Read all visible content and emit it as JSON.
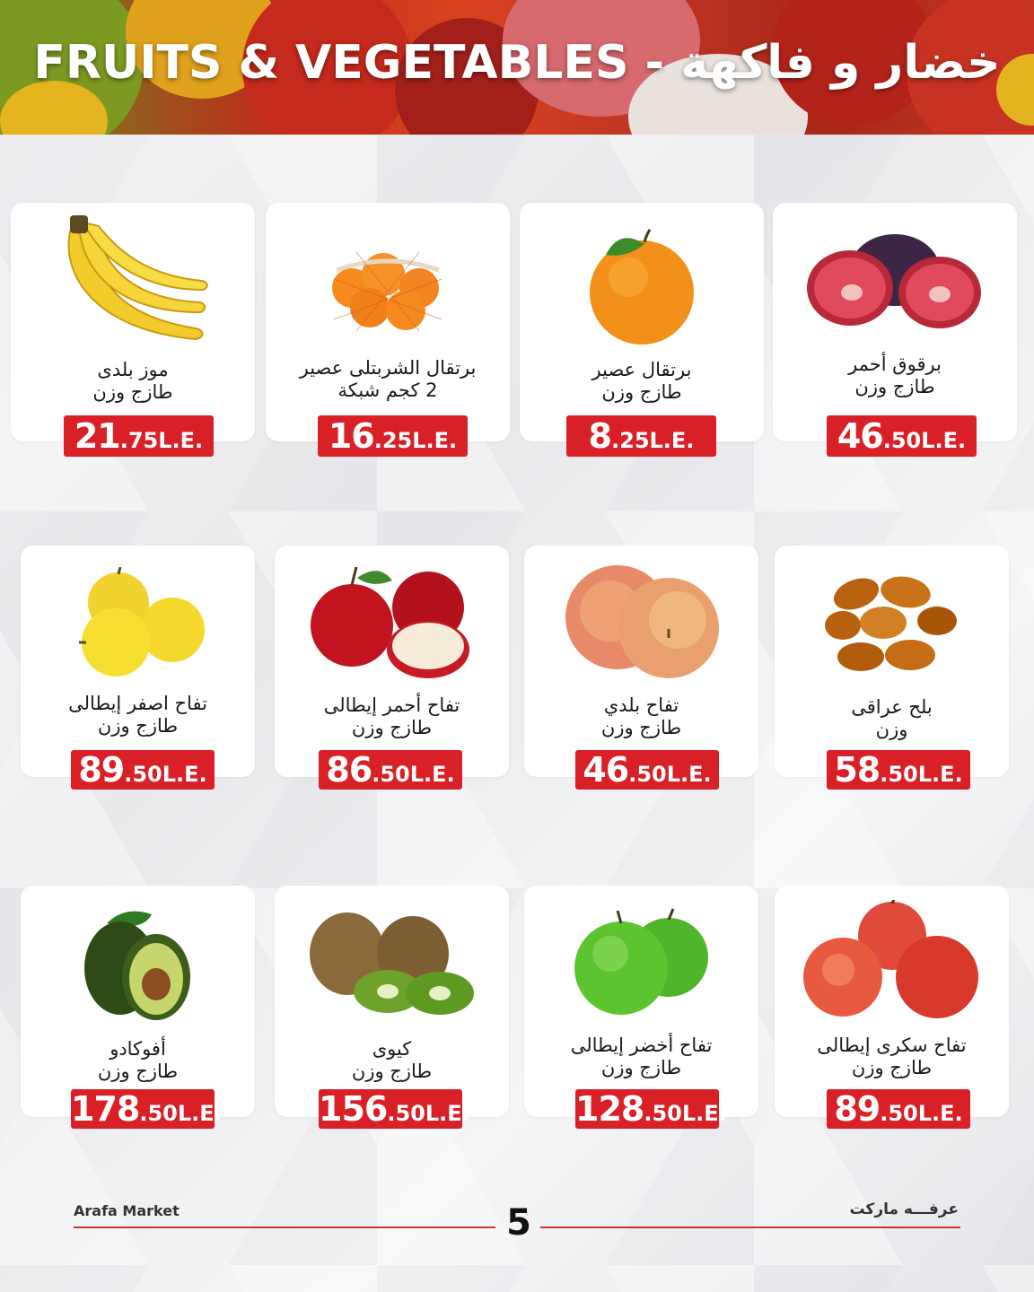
{
  "header": {
    "title": "FRUITS & VEGETABLES - خضار و فاكهة"
  },
  "products": [
    {
      "name_line1": "موز بلدى",
      "name_line2": "طازج وزن",
      "price_main": "21",
      "price_rest": ".75L.E.",
      "icon": "banana-icon"
    },
    {
      "name_line1": "برتقال الشربتلى عصير",
      "name_line2": "2 كجم شبكة",
      "price_main": "16",
      "price_rest": ".25L.E.",
      "icon": "orange-net-icon"
    },
    {
      "name_line1": "برتقال عصير",
      "name_line2": "طازج وزن",
      "price_main": "8",
      "price_rest": ".25L.E.",
      "icon": "orange-icon"
    },
    {
      "name_line1": "برقوق أحمر",
      "name_line2": "طازج وزن",
      "price_main": "46",
      "price_rest": ".50L.E.",
      "icon": "plum-icon"
    },
    {
      "name_line1": "تفاح اصفر إيطالى",
      "name_line2": "طازج وزن",
      "price_main": "89",
      "price_rest": ".50L.E.",
      "icon": "yellow-apple-icon"
    },
    {
      "name_line1": "تفاح أحمر إيطالى",
      "name_line2": "طازج وزن",
      "price_main": "86",
      "price_rest": ".50L.E.",
      "icon": "red-apple-icon"
    },
    {
      "name_line1": "تفاح بلدي",
      "name_line2": "طازج وزن",
      "price_main": "46",
      "price_rest": ".50L.E.",
      "icon": "local-apple-icon"
    },
    {
      "name_line1": "بلح عراقى",
      "name_line2": "وزن",
      "price_main": "58",
      "price_rest": ".50L.E.",
      "icon": "dates-icon"
    },
    {
      "name_line1": "أفوكادو",
      "name_line2": "طازج وزن",
      "price_main": "178",
      "price_rest": ".50L.E.",
      "icon": "avocado-icon"
    },
    {
      "name_line1": "كيوى",
      "name_line2": "طازج وزن",
      "price_main": "156",
      "price_rest": ".50L.E.",
      "icon": "kiwi-icon"
    },
    {
      "name_line1": "تفاح أخضر إيطالى",
      "name_line2": "طازج وزن",
      "price_main": "128",
      "price_rest": ".50L.E.",
      "icon": "green-apple-icon"
    },
    {
      "name_line1": "تفاح سكرى إيطالى",
      "name_line2": "طازج وزن",
      "price_main": "89",
      "price_rest": ".50L.E.",
      "icon": "sugar-apple-icon"
    }
  ],
  "footer": {
    "brand_en": "Arafa Market",
    "brand_ar": "عرفـــه ماركت",
    "page_number": "5"
  },
  "colors": {
    "price_badge": "#d92027",
    "footer_line": "#c23a34"
  }
}
